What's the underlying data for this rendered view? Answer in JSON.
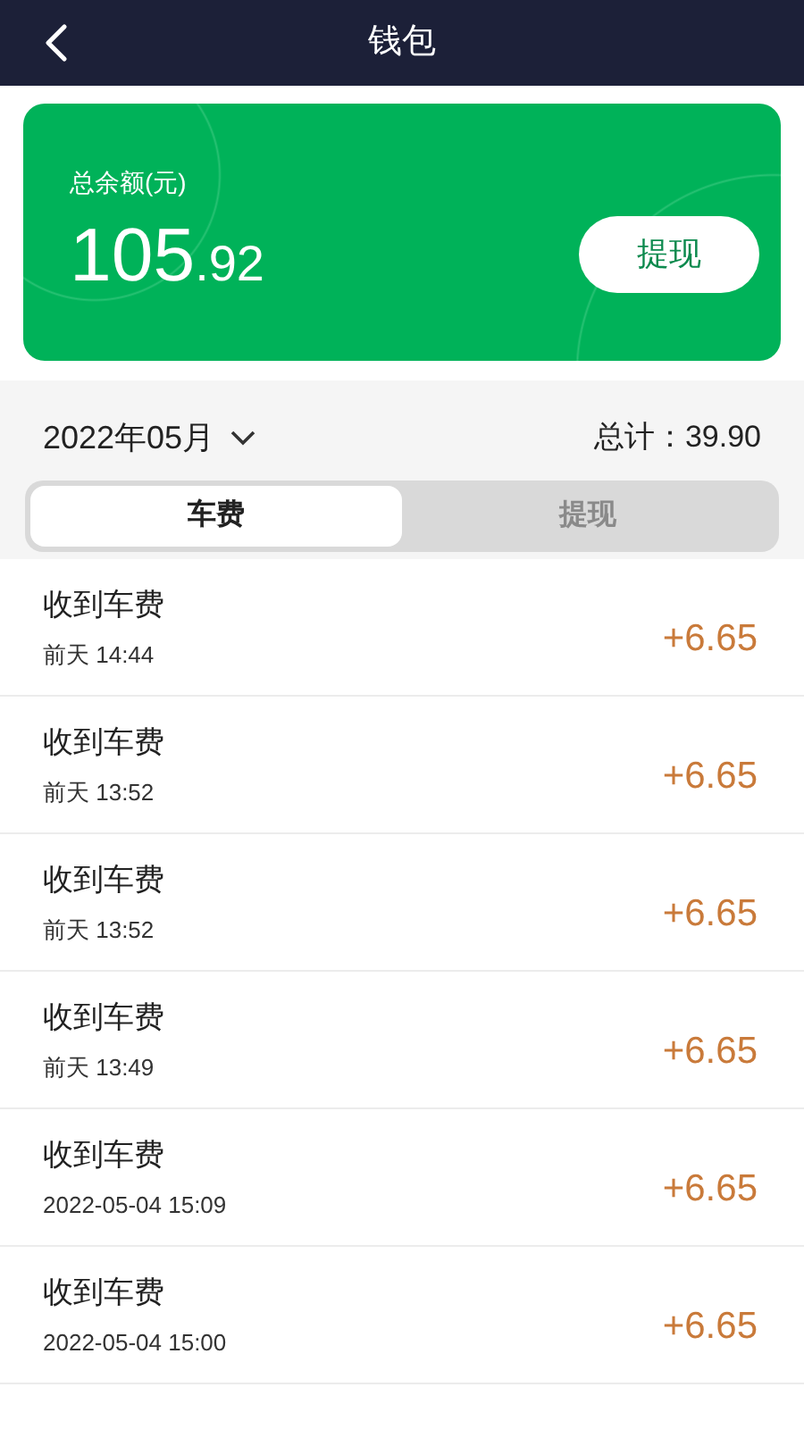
{
  "header": {
    "title": "钱包"
  },
  "balance": {
    "label": "总余额(元)",
    "amount_integer": "105",
    "amount_decimal": ".92",
    "button": "提现"
  },
  "filter": {
    "month": "2022年05月",
    "total_label": "总计：",
    "total_value": "39.90"
  },
  "tabs": [
    {
      "label": "车费",
      "selected": true
    },
    {
      "label": "提现",
      "selected": false
    }
  ],
  "records": [
    {
      "title": "收到车费",
      "time": "前天 14:44",
      "amount": "+6.65"
    },
    {
      "title": "收到车费",
      "time": "前天 13:52",
      "amount": "+6.65"
    },
    {
      "title": "收到车费",
      "time": "前天 13:52",
      "amount": "+6.65"
    },
    {
      "title": "收到车费",
      "time": "前天 13:49",
      "amount": "+6.65"
    },
    {
      "title": "收到车费",
      "time": "2022-05-04 15:09",
      "amount": "+6.65"
    },
    {
      "title": "收到车费",
      "time": "2022-05-04 15:00",
      "amount": "+6.65"
    }
  ]
}
